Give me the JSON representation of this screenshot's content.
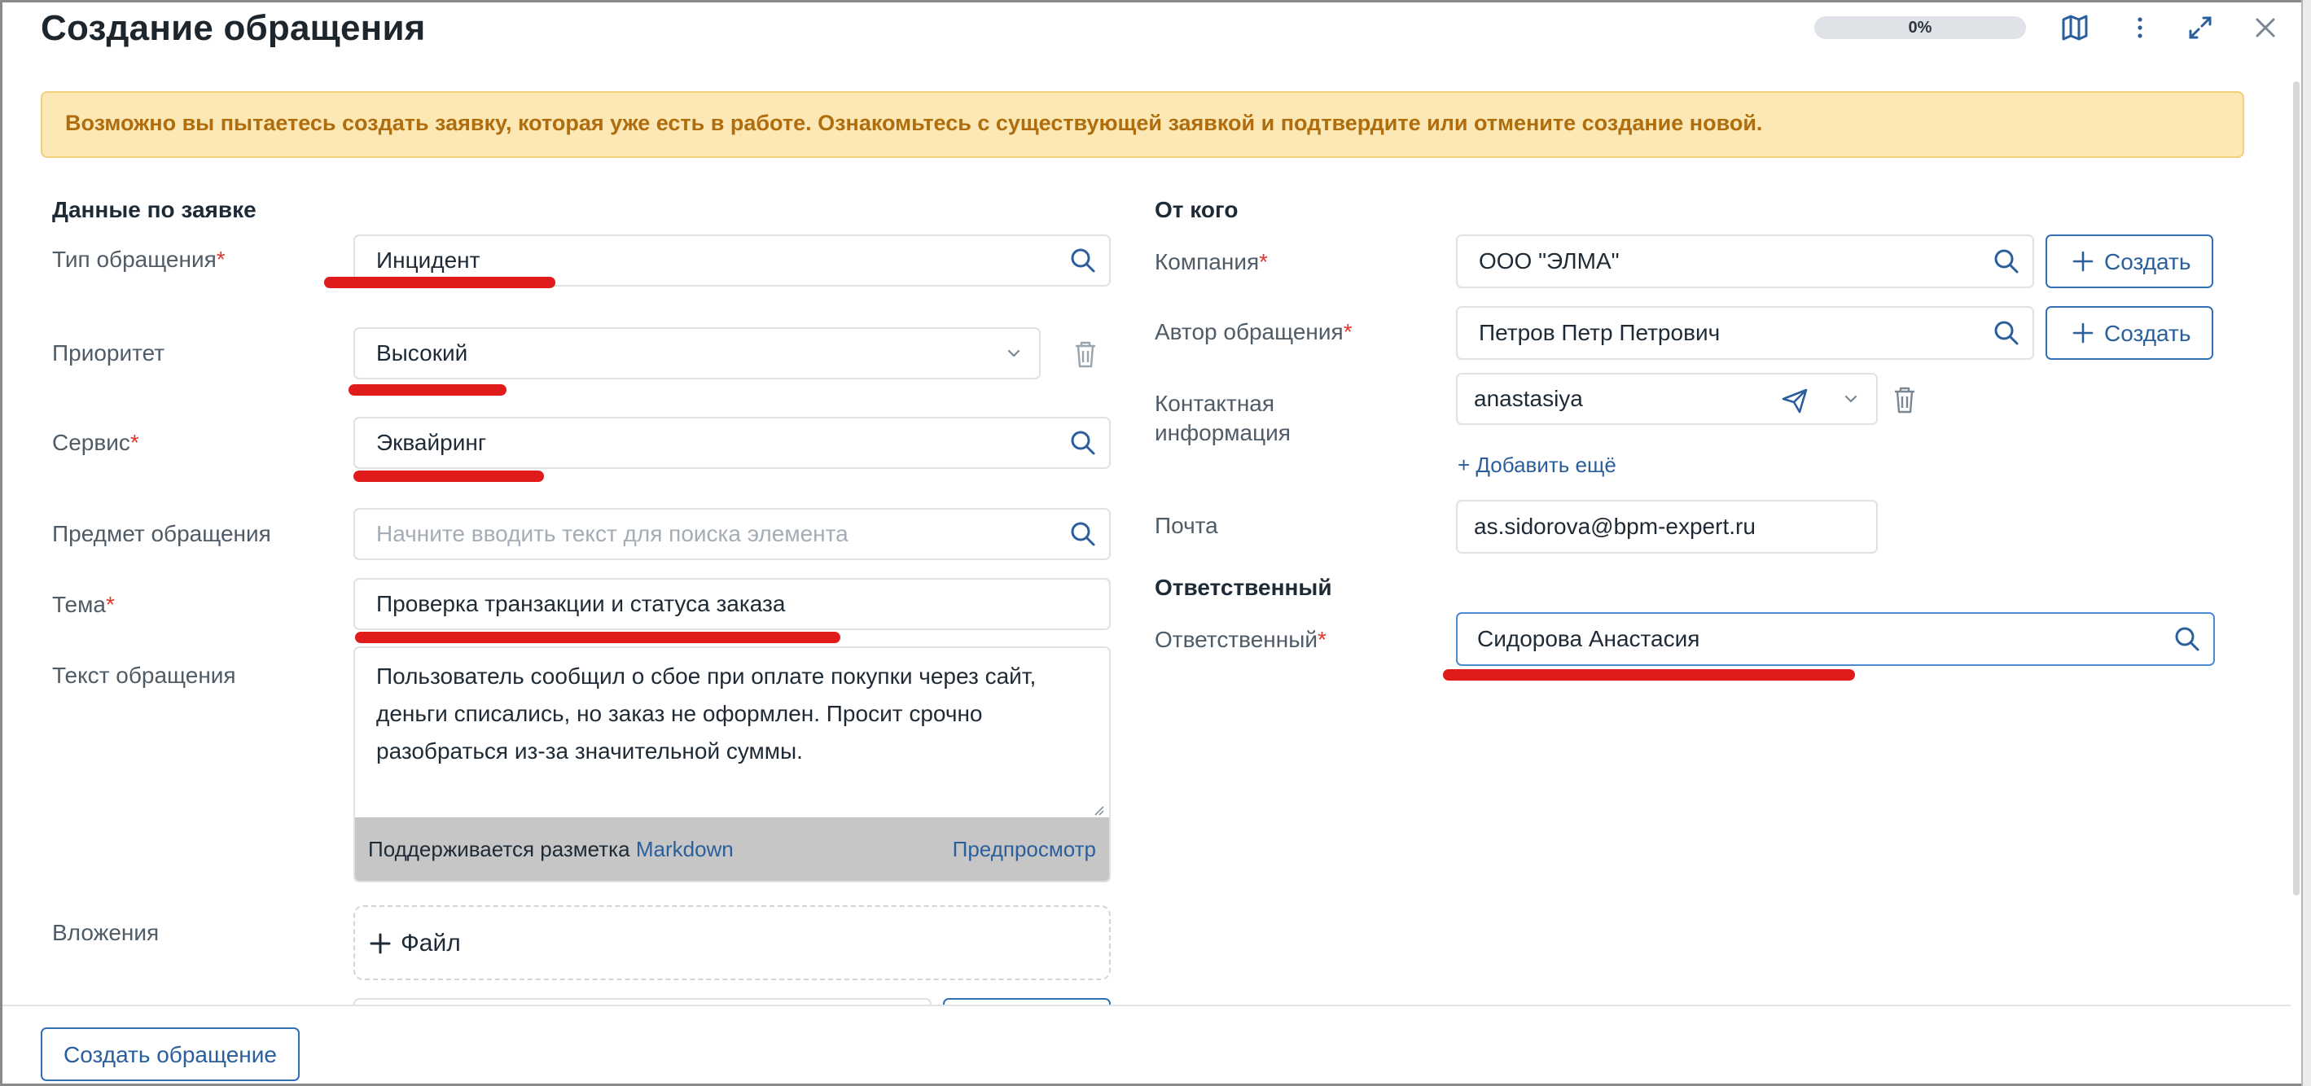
{
  "header": {
    "title": "Создание обращения",
    "progress": "0%",
    "progress_value": 0,
    "icons": [
      "map-icon",
      "more-vertical-icon",
      "expand-icon",
      "close-icon"
    ]
  },
  "warning": "Возможно вы пытаетесь создать заявку, которая уже есть в работе. Ознакомьтесь с существующей заявкой и подтвердите или отмените создание новой.",
  "left": {
    "section_title": "Данные по заявке",
    "type": {
      "label": "Тип обращения",
      "value": "Инцидент"
    },
    "priority": {
      "label": "Приоритет",
      "value": "Высокий"
    },
    "service": {
      "label": "Сервис",
      "value": "Эквайринг"
    },
    "subject": {
      "label": "Предмет обращения",
      "placeholder": "Начните вводить текст для поиска элемента"
    },
    "topic": {
      "label": "Тема",
      "value": "Проверка транзакции и статуса заказа"
    },
    "text": {
      "label": "Текст обращения",
      "value": "Пользователь сообщил о сбое при оплате покупки через сайт, деньги списались, но заказ не оформлен. Просит срочно разобраться из-за значительной суммы.",
      "markup_note": "Поддерживается разметка",
      "markup_link": "Markdown",
      "preview": "Предпросмотр"
    },
    "attachments": {
      "label": "Вложения",
      "button": "Файл"
    }
  },
  "right": {
    "section_title": "От кого",
    "company": {
      "label": "Компания",
      "value": "ООО \"ЭЛМА\"",
      "create": "Создать"
    },
    "author": {
      "label": "Автор обращения",
      "value": "Петров Петр Петрович",
      "create": "Создать"
    },
    "contact": {
      "label_line1": "Контактная",
      "label_line2": "информация",
      "value": "anastasiya",
      "add_more": "+ Добавить ещё"
    },
    "email": {
      "label": "Почта",
      "value": "as.sidorova@bpm-expert.ru"
    },
    "responsible_section": "Ответственный",
    "responsible": {
      "label": "Ответственный",
      "value": "Сидорова Анастасия"
    }
  },
  "footer": {
    "submit": "Создать обращение"
  },
  "colors": {
    "accent": "#2f6fb2",
    "warning_bg": "#fbe8b5",
    "warning_text": "#b06d0d",
    "required": "#e2362c",
    "annotation": "#e01b1b"
  }
}
